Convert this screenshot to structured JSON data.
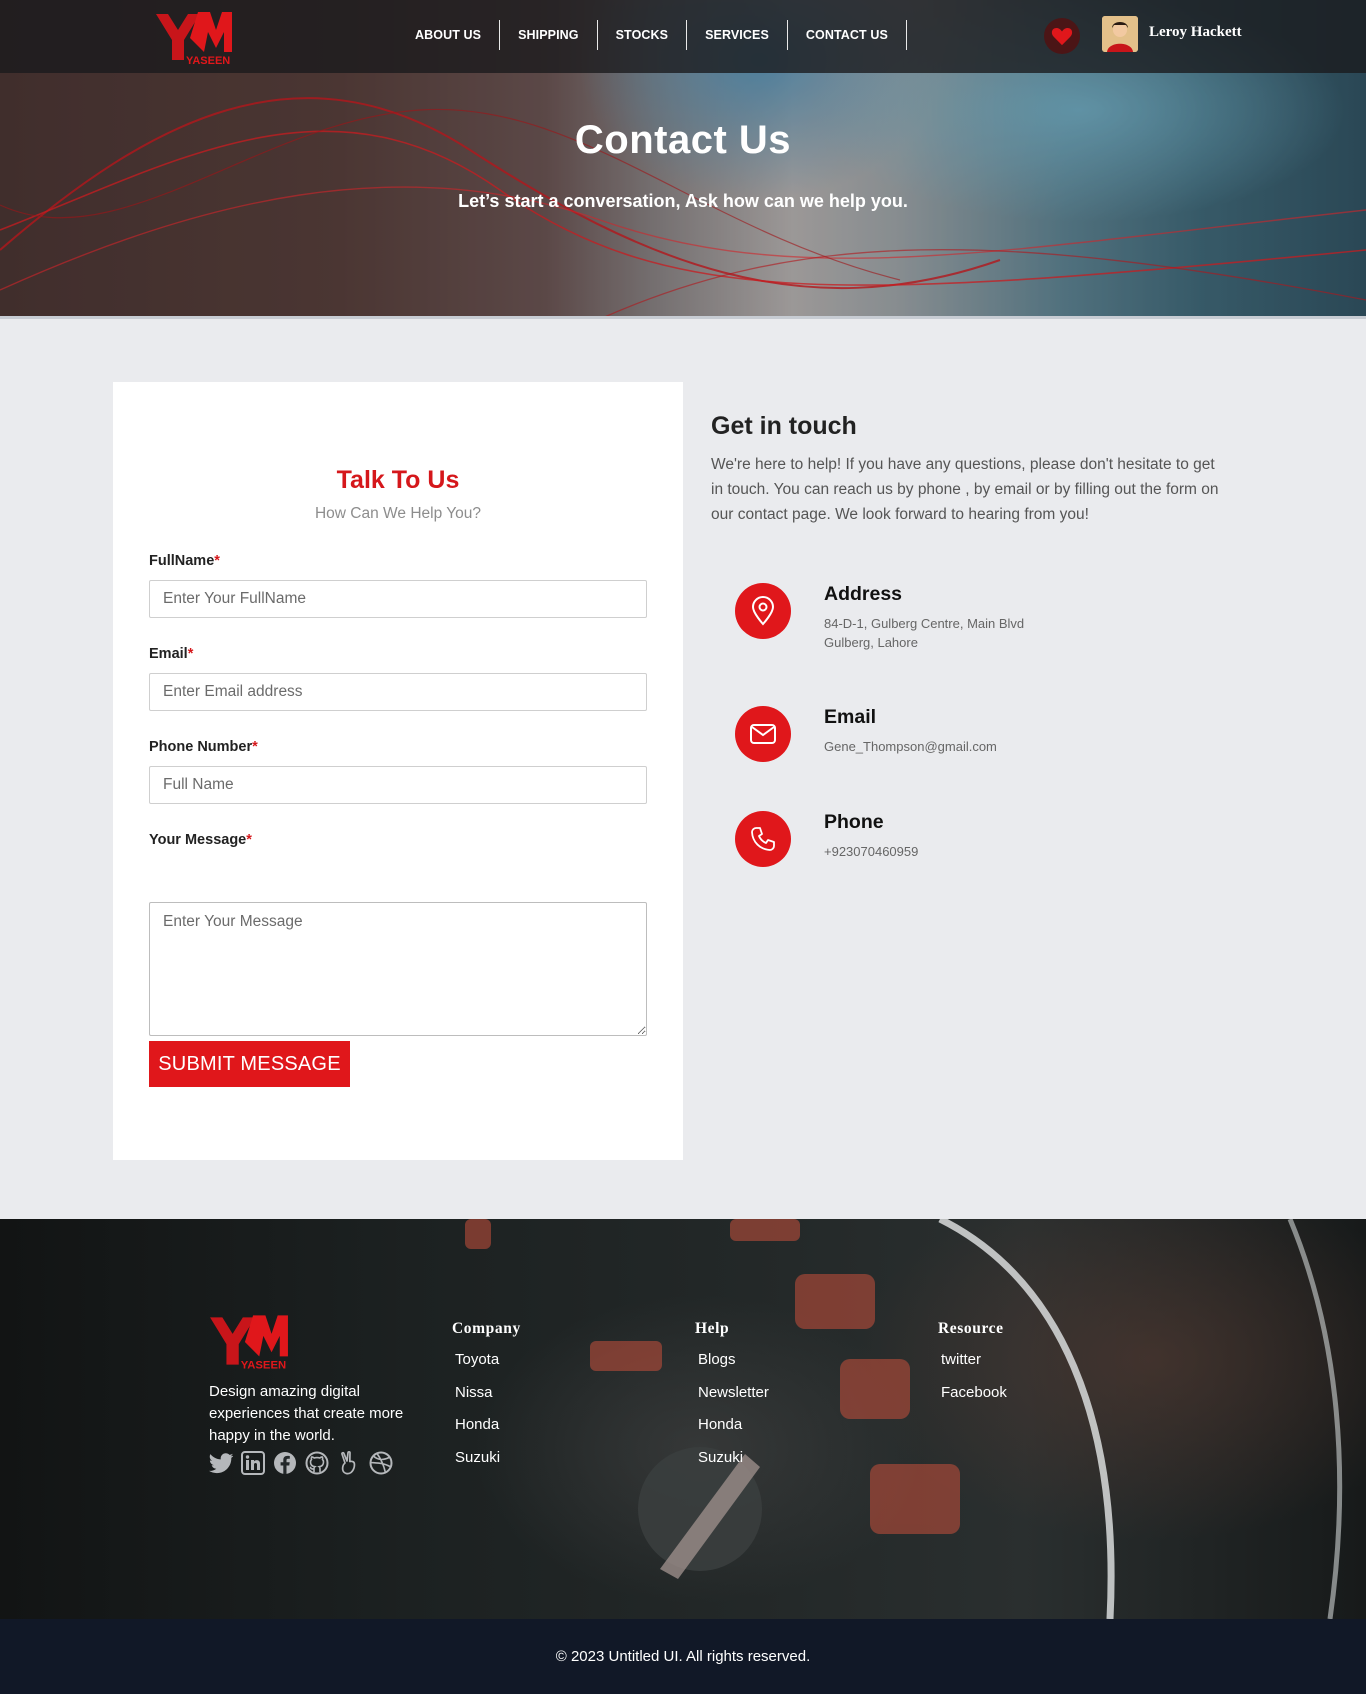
{
  "brand": {
    "logo_text": "YASEEN",
    "accent": "#e0171b",
    "dark": "#111827"
  },
  "nav": {
    "links": [
      "ABOUT US",
      "SHIPPING",
      "STOCKS",
      "SERVICES",
      "CONTACT US"
    ],
    "heart_icon": "heart-icon",
    "user_name": "Leroy Hackett"
  },
  "hero": {
    "title": "Contact Us",
    "subtitle": "Let’s start a conversation, Ask how can we help you."
  },
  "form": {
    "title": "Talk To Us",
    "subtitle": "How Can We Help You?",
    "required_mark": "*",
    "fields": [
      {
        "label": "FullName",
        "placeholder": "Enter Your FullName",
        "value": ""
      },
      {
        "label": "Email",
        "placeholder": "Enter Email address",
        "value": ""
      },
      {
        "label": "Phone Number",
        "placeholder": "Full Name",
        "value": ""
      },
      {
        "label": "Your Message",
        "placeholder": "Enter Your Message",
        "value": ""
      }
    ],
    "submit_label": "SUBMIT MESSAGE"
  },
  "contact_info": {
    "title": "Get in touch",
    "description": "We're here to help! If you have any questions, please don't hesitate to get in touch. You can reach us by phone , by email or by filling out the form on our contact page. We look forward to hearing from you!",
    "items": [
      {
        "icon": "location-pin-icon",
        "title": "Address",
        "line1": "84-D-1, Gulberg Centre, Main Blvd",
        "line2": "Gulberg, Lahore"
      },
      {
        "icon": "mail-icon",
        "title": "Email",
        "line1": "Gene_Thompson@gmail.com",
        "line2": ""
      },
      {
        "icon": "phone-icon",
        "title": "Phone",
        "line1": "+923070460959",
        "line2": ""
      }
    ]
  },
  "footer": {
    "tagline": "Design amazing digital experiences that create more happy in the world.",
    "social": [
      "twitter-icon",
      "linkedin-icon",
      "facebook-icon",
      "github-icon",
      "peace-hand-icon",
      "dribbble-icon"
    ],
    "columns": [
      {
        "title": "Company",
        "links": [
          "Toyota",
          "Nissa",
          "Honda",
          "Suzuki"
        ]
      },
      {
        "title": "Help",
        "links": [
          "Blogs",
          "Newsletter",
          "Honda",
          "Suzuki"
        ]
      },
      {
        "title": "Resource",
        "links": [
          "twitter",
          "Facebook"
        ]
      }
    ],
    "copyright": "© 2023 Untitled UI. All rights reserved."
  }
}
